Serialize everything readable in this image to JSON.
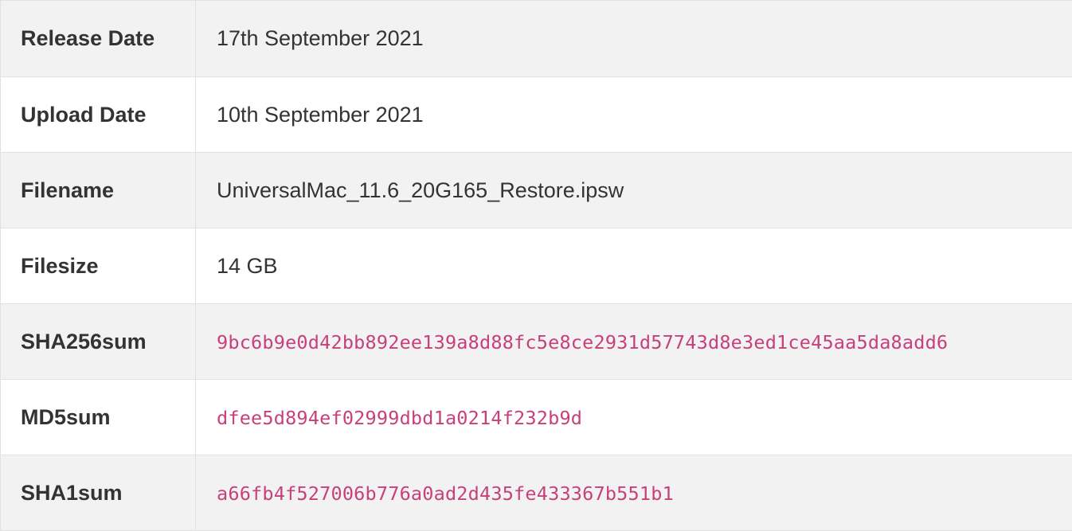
{
  "rows": [
    {
      "label": "Release Date",
      "value": "17th September 2021"
    },
    {
      "label": "Upload Date",
      "value": "10th September 2021"
    },
    {
      "label": "Filename",
      "value": "UniversalMac_11.6_20G165_Restore.ipsw"
    },
    {
      "label": "Filesize",
      "value": "14 GB"
    },
    {
      "label": "SHA256sum",
      "value": "9bc6b9e0d42bb892ee139a8d88fc5e8ce2931d57743d8e3ed1ce45aa5da8add6"
    },
    {
      "label": "MD5sum",
      "value": "dfee5d894ef02999dbd1a0214f232b9d"
    },
    {
      "label": "SHA1sum",
      "value": "a66fb4f527006b776a0ad2d435fe433367b551b1"
    }
  ],
  "colors": {
    "hash_text": "#c7407a",
    "label_text": "#333333",
    "row_alt_bg": "#f2f2f2",
    "border": "#e1e1e1"
  }
}
